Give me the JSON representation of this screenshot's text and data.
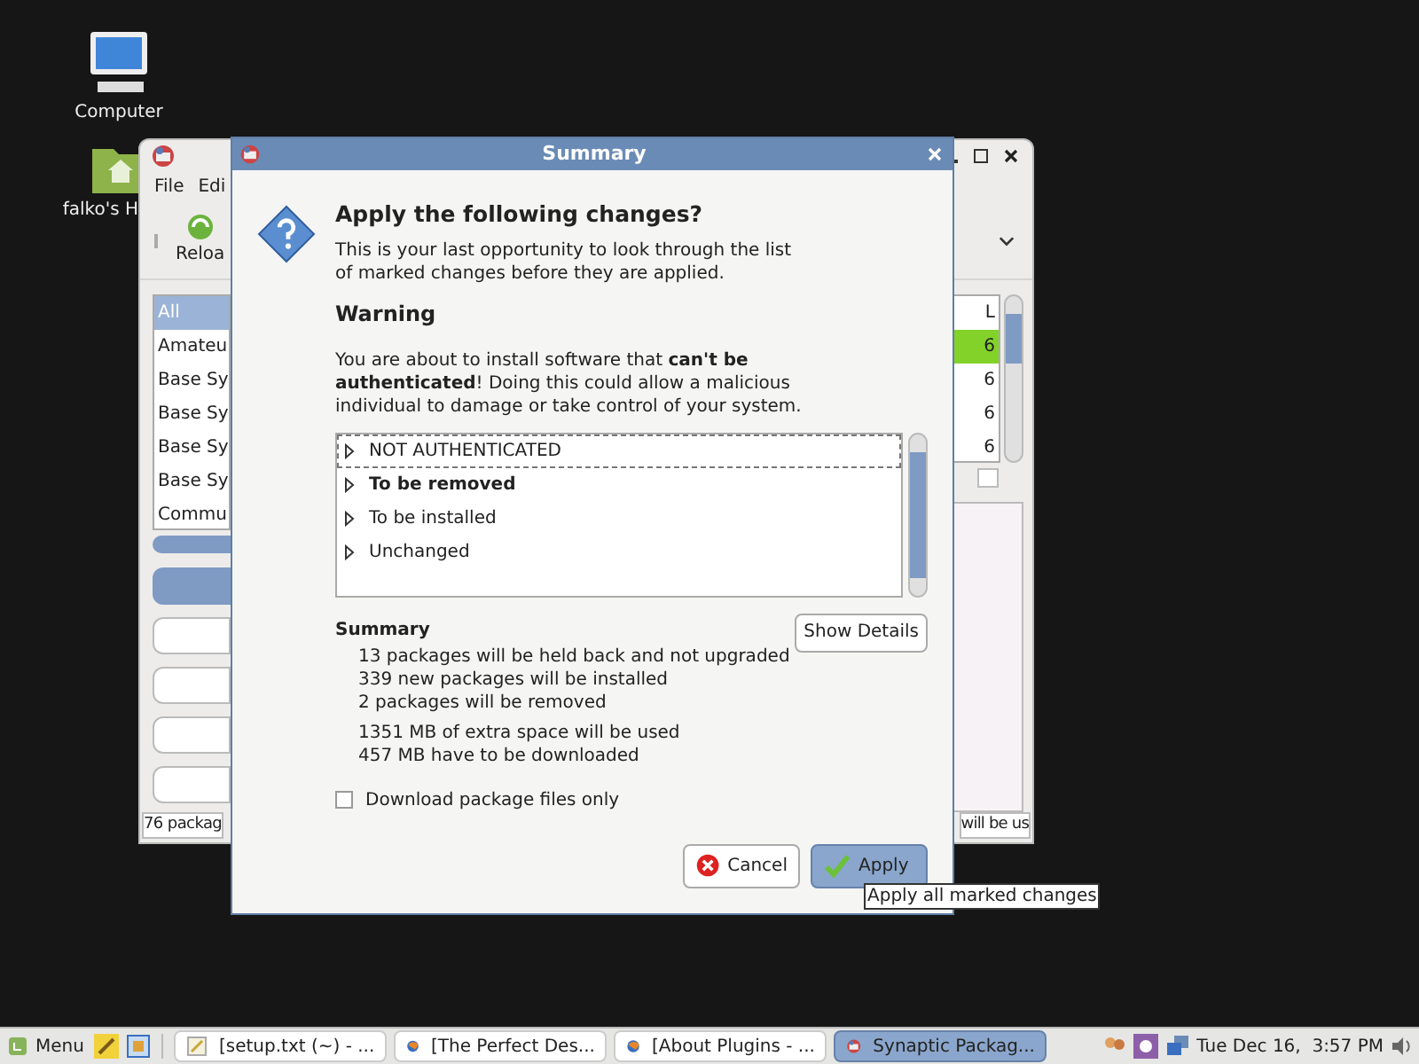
{
  "desktop_icons": [
    {
      "label": "Computer",
      "kind": "computer"
    },
    {
      "label": "falko's H",
      "kind": "home"
    }
  ],
  "back_window": {
    "menu": [
      "File",
      "Edi"
    ],
    "toolbar": [
      "Reloa"
    ],
    "categories": [
      {
        "label": "All",
        "selected": true
      },
      {
        "label": "Amateu",
        "selected": false
      },
      {
        "label": "Base Sy",
        "selected": false
      },
      {
        "label": "Base Sy",
        "selected": false
      },
      {
        "label": "Base Sy",
        "selected": false
      },
      {
        "label": "Base Sy",
        "selected": false
      },
      {
        "label": "Commu",
        "selected": false
      }
    ],
    "column_header": "L",
    "cells": [
      {
        "text": "6",
        "selected": true
      },
      {
        "text": "6",
        "selected": false
      },
      {
        "text": "6",
        "selected": false
      },
      {
        "text": "6",
        "selected": false
      }
    ],
    "status_left": "76 packag",
    "status_right": "will be us"
  },
  "dialog": {
    "title": "Summary",
    "heading": "Apply the following changes?",
    "intro": "This is your last opportunity to look through the list of marked changes before they are applied.",
    "warning_title": "Warning",
    "warning_text": "You are about to install software that **can't be authenticated**! Doing this could allow a malicious individual to damage or take control of your system.",
    "changes": [
      {
        "label": "NOT AUTHENTICATED",
        "bold": false,
        "focused": true
      },
      {
        "label": "To be removed",
        "bold": true,
        "focused": false
      },
      {
        "label": "To be installed",
        "bold": false,
        "focused": false
      },
      {
        "label": "Unchanged",
        "bold": false,
        "focused": false
      }
    ],
    "summary_title": "Summary",
    "show_details": "Show Details",
    "summary_groups": [
      [
        "13 packages will be held back and not upgraded",
        "339 new packages will be installed",
        "2 packages will be removed"
      ],
      [
        "1351 MB of extra space will be used",
        "457 MB have to be downloaded"
      ]
    ],
    "download_only": {
      "label": "Download package files only",
      "checked": false
    },
    "buttons": [
      {
        "label": "Cancel",
        "kind": "cancel",
        "default": false
      },
      {
        "label": "Apply",
        "kind": "apply",
        "default": true
      }
    ],
    "tooltip": "Apply all marked changes"
  },
  "taskbar": {
    "menu": "Menu",
    "tasks": [
      {
        "label": "[setup.txt (~) - ...",
        "kind": "editor",
        "selected": false
      },
      {
        "label": "[The Perfect Des...",
        "kind": "browser",
        "selected": false
      },
      {
        "label": "[About Plugins - ...",
        "kind": "browser",
        "selected": false
      },
      {
        "label": "Synaptic Packag...",
        "kind": "synaptic",
        "selected": true
      }
    ],
    "clock": "Tue Dec 16,  3:57 PM"
  }
}
